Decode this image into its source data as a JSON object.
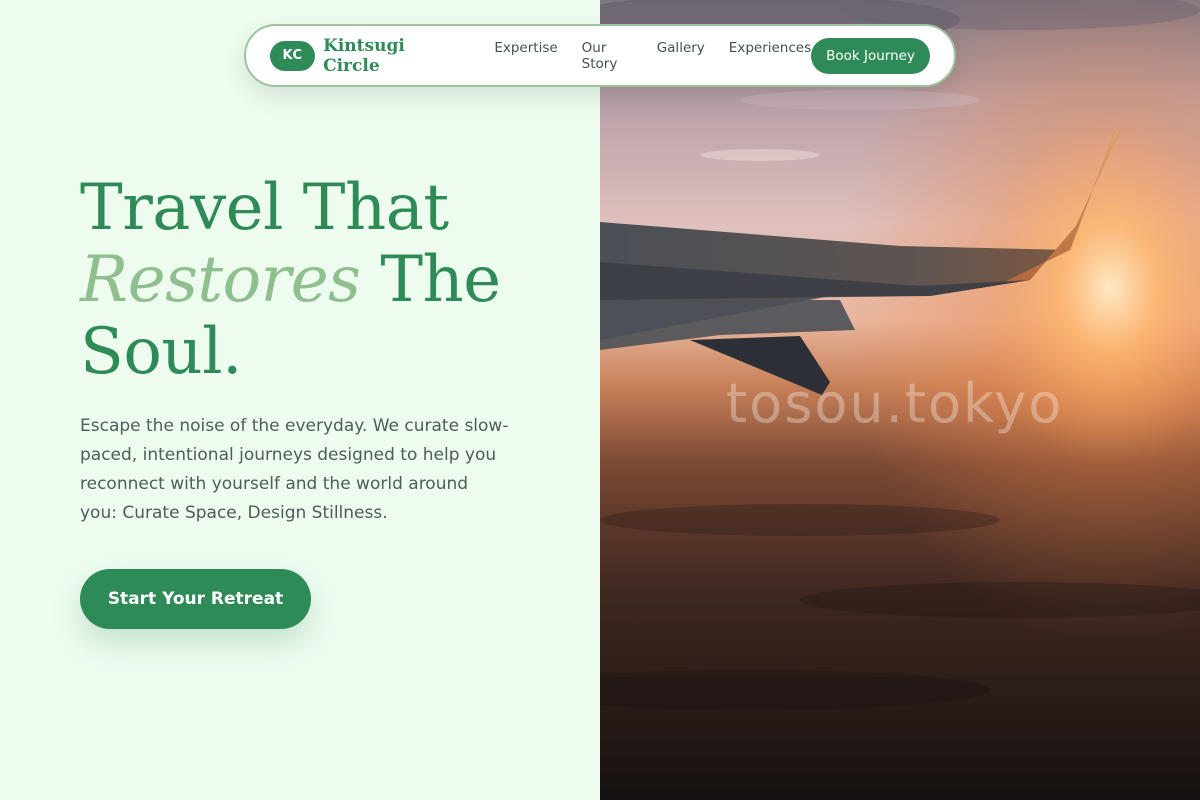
{
  "nav": {
    "logo_text": "KC",
    "brand": "Kintsugi Circle",
    "links": [
      "Expertise",
      "Our Story",
      "Gallery",
      "Experiences"
    ],
    "cta_label": "Book Journey"
  },
  "hero": {
    "headline_line1": "Travel That",
    "headline_accent": "Restores",
    "headline_line2_rest": "The",
    "headline_line3": "Soul.",
    "lead": "Escape the noise of the everyday. We curate slow-paced, intentional journeys designed to help you reconnect with yourself and the world around you: Curate Space, Design Stillness.",
    "cta_label": "Start Your Retreat"
  },
  "image": {
    "watermark": "tosou.tokyo",
    "subject_icon": "airplane-wing-sunset-photo"
  },
  "colors": {
    "brand_green": "#2e8b57",
    "accent_green": "#8fbf8f",
    "background": "#eefcf0",
    "body_text": "#4e5d57"
  }
}
